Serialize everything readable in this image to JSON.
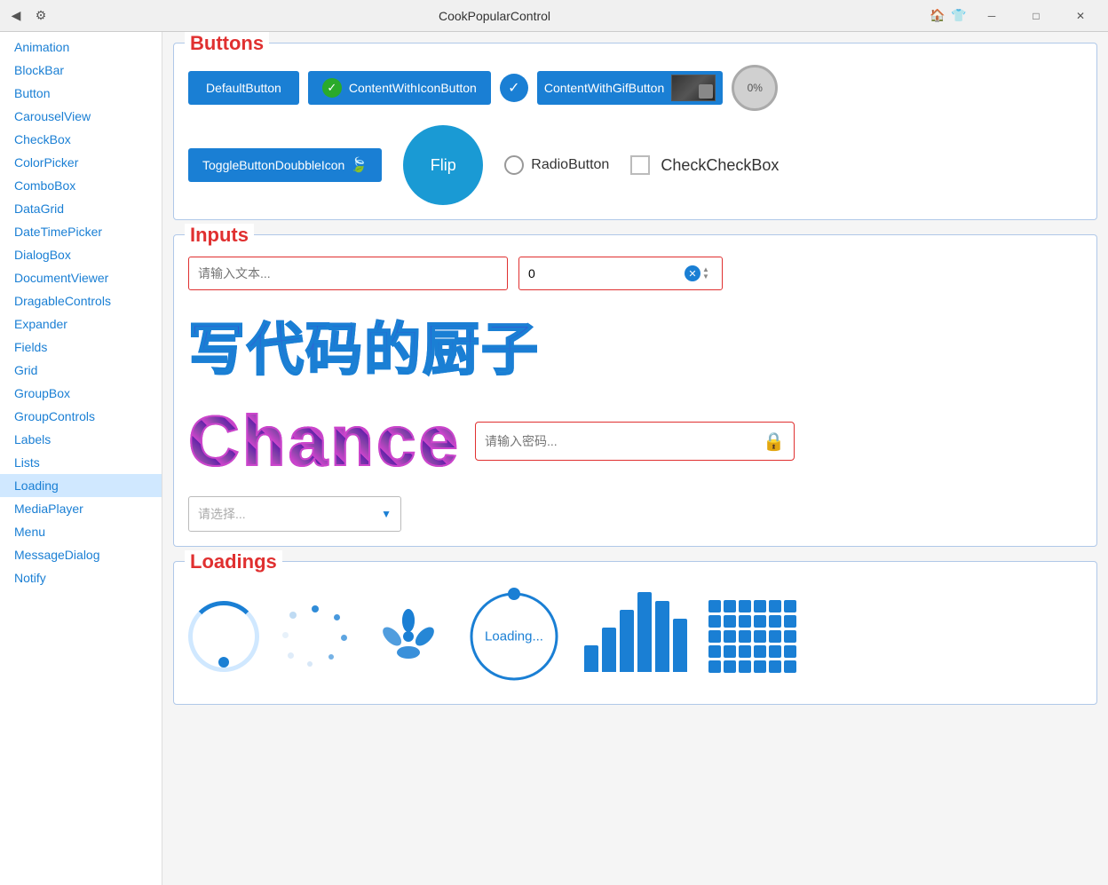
{
  "titleBar": {
    "title": "CookPopularControl",
    "backLabel": "←",
    "settingsLabel": "⚙",
    "homeLabel": "🏠",
    "shirtLabel": "👕",
    "minLabel": "─",
    "maxLabel": "□",
    "closeLabel": "✕"
  },
  "sidebar": {
    "items": [
      {
        "label": "Animation",
        "id": "animation"
      },
      {
        "label": "BlockBar",
        "id": "blockbar"
      },
      {
        "label": "Button",
        "id": "button"
      },
      {
        "label": "CarouselView",
        "id": "carouselview"
      },
      {
        "label": "CheckBox",
        "id": "checkbox"
      },
      {
        "label": "ColorPicker",
        "id": "colorpicker"
      },
      {
        "label": "ComboBox",
        "id": "combobox"
      },
      {
        "label": "DataGrid",
        "id": "datagrid"
      },
      {
        "label": "DateTimePicker",
        "id": "datetimepicker"
      },
      {
        "label": "DialogBox",
        "id": "dialogbox"
      },
      {
        "label": "DocumentViewer",
        "id": "documentviewer"
      },
      {
        "label": "DragableControls",
        "id": "dragablecontrols"
      },
      {
        "label": "Expander",
        "id": "expander"
      },
      {
        "label": "Fields",
        "id": "fields"
      },
      {
        "label": "Grid",
        "id": "grid"
      },
      {
        "label": "GroupBox",
        "id": "groupbox"
      },
      {
        "label": "GroupControls",
        "id": "groupcontrols"
      },
      {
        "label": "Labels",
        "id": "labels"
      },
      {
        "label": "Lists",
        "id": "lists"
      },
      {
        "label": "Loading",
        "id": "loading"
      },
      {
        "label": "MediaPlayer",
        "id": "mediaplayer"
      },
      {
        "label": "Menu",
        "id": "menu"
      },
      {
        "label": "MessageDialog",
        "id": "messagedialog"
      },
      {
        "label": "Notify",
        "id": "notify"
      }
    ]
  },
  "buttons": {
    "sectionTitle": "Buttons",
    "defaultButton": "DefaultButton",
    "contentWithIconButton": "ContentWithIconButton",
    "contentWithGifButton": "ContentWithGifButton",
    "progressButton": "0%",
    "toggleButton": "ToggleButtonDoubbleIcon",
    "flipButton": "Flip",
    "radioButton": "RadioButton",
    "checkCheckBox": "CheckCheckBox"
  },
  "inputs": {
    "sectionTitle": "Inputs",
    "textPlaceholder": "请输入文本...",
    "numberValue": "0",
    "bigText": "写代码的厨子",
    "chanceText": "Chance",
    "passwordPlaceholder": "请输入密码...",
    "dropdownPlaceholder": "请选择..."
  },
  "loadings": {
    "sectionTitle": "Loadings",
    "loadingText": "Loading...",
    "bars": [
      30,
      50,
      70,
      90,
      80,
      60
    ],
    "gridRows": 5,
    "gridCols": 6
  }
}
